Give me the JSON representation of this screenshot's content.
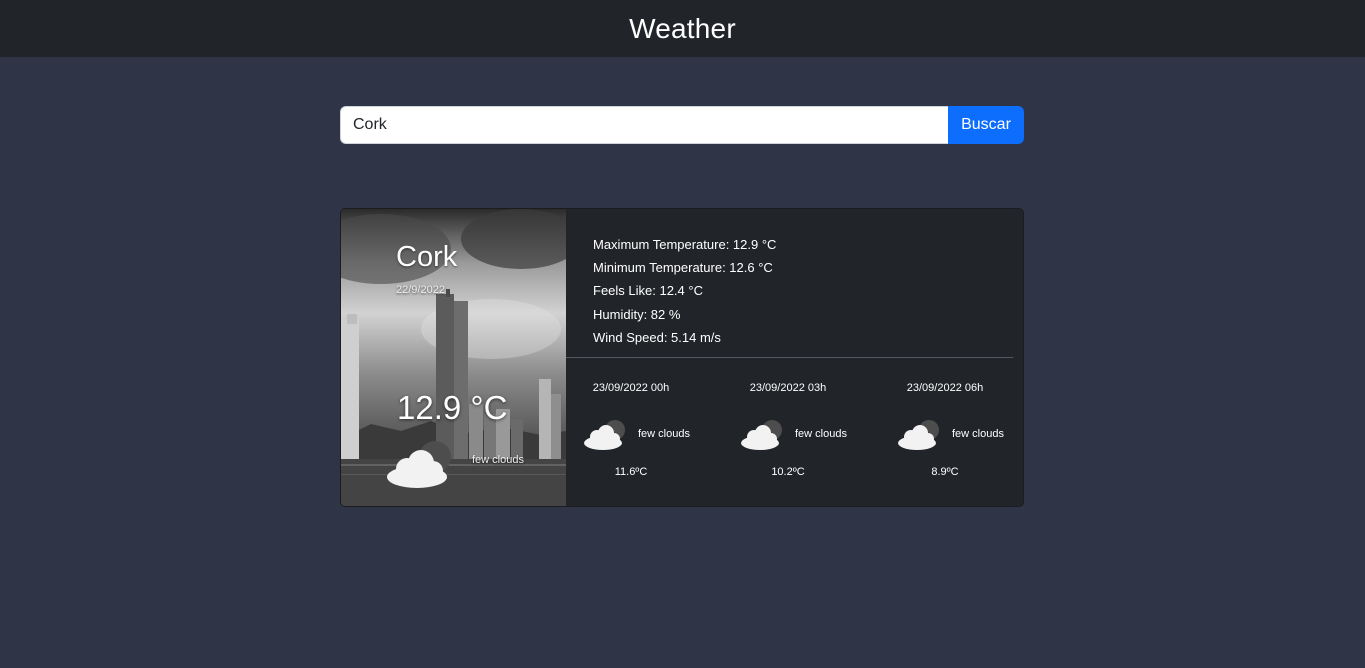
{
  "header": {
    "title": "Weather"
  },
  "search": {
    "value": "Cork",
    "button_label": "Buscar"
  },
  "current": {
    "city": "Cork",
    "date": "22/9/2022",
    "temperature": "12.9 °C",
    "description": "few clouds",
    "icon": "few-clouds-icon"
  },
  "details": [
    {
      "text": "Maximum Temperature: 12.9 °C"
    },
    {
      "text": "Minimum Temperature: 12.6 °C"
    },
    {
      "text": "Feels Like: 12.4 °C"
    },
    {
      "text": "Humidity: 82 %"
    },
    {
      "text": "Wind Speed: 5.14 m/s"
    }
  ],
  "forecast": [
    {
      "time": "23/09/2022 00h",
      "description": "few clouds",
      "temp": "11.6ºC",
      "icon": "few-clouds-icon"
    },
    {
      "time": "23/09/2022 03h",
      "description": "few clouds",
      "temp": "10.2ºC",
      "icon": "few-clouds-icon"
    },
    {
      "time": "23/09/2022 06h",
      "description": "few clouds",
      "temp": "8.9ºC",
      "icon": "few-clouds-icon"
    }
  ]
}
